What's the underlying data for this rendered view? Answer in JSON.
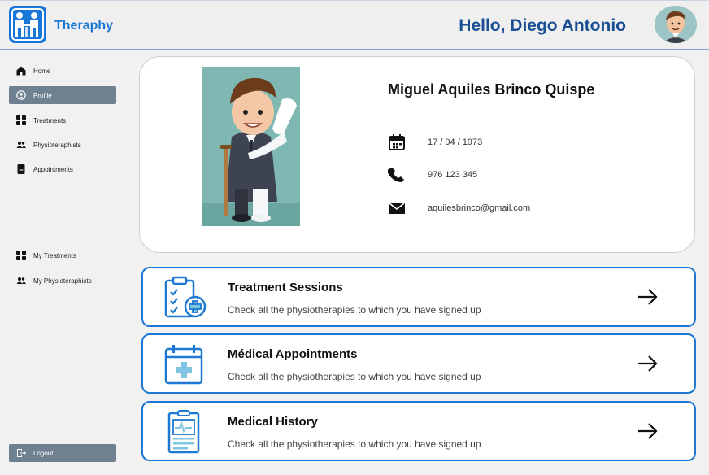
{
  "header": {
    "brand": "Theraphy",
    "greeting": "Hello, Diego Antonio"
  },
  "sidebar": {
    "items": [
      {
        "label": "Home",
        "icon": "home-icon",
        "active": false
      },
      {
        "label": "Profile",
        "icon": "user-circle-icon",
        "active": true
      },
      {
        "label": "Treatments",
        "icon": "grid-icon",
        "active": false
      },
      {
        "label": "Physioteraphists",
        "icon": "people-icon",
        "active": false
      },
      {
        "label": "Appointments",
        "icon": "document-icon",
        "active": false
      }
    ],
    "secondary": [
      {
        "label": "My Treatments",
        "icon": "grid-icon"
      },
      {
        "label": "My Physioteraphists",
        "icon": "people-icon"
      }
    ],
    "logout_label": "Logout"
  },
  "profile": {
    "name": "Miguel Aquiles Brinco Quispe",
    "birthdate": "17 / 04 / 1973",
    "phone": "976 123 345",
    "email": "aquilesbrinco@gmail.com"
  },
  "options": [
    {
      "title": "Treatment Sessions",
      "description": "Check all the physiotherapies to which you have signed up",
      "icon": "clipboard-plus-icon"
    },
    {
      "title": "Médical Appointments",
      "description": "Check all the physiotherapies to which you have signed up",
      "icon": "calendar-plus-icon"
    },
    {
      "title": "Medical History",
      "description": "Check all the physiotherapies to which you have signed up",
      "icon": "medical-record-icon"
    }
  ],
  "colors": {
    "accent": "#1c78d0",
    "brand_text": "#1a77d4",
    "greeting_text": "#1b4f93",
    "sidebar_active": "#6f8191"
  }
}
